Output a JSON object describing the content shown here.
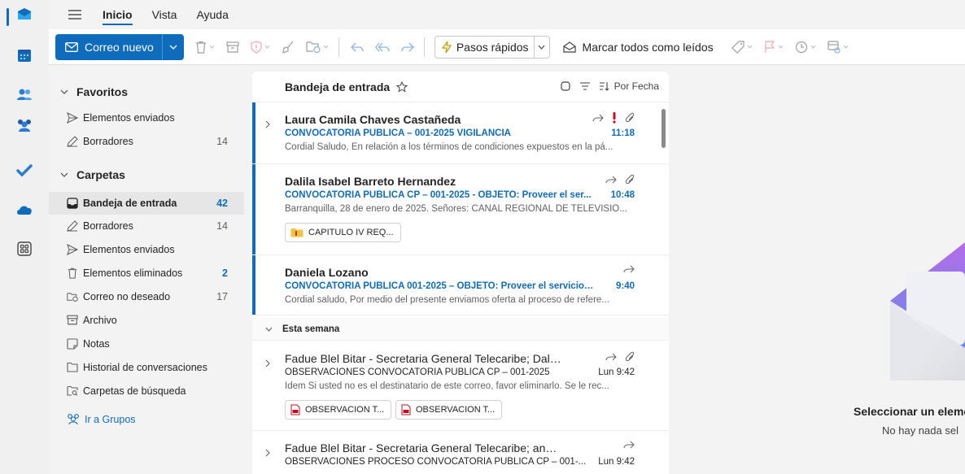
{
  "menu": {
    "tabs": [
      "Inicio",
      "Vista",
      "Ayuda"
    ]
  },
  "toolbar": {
    "new_mail": "Correo nuevo",
    "quick_steps": "Pasos rápidos",
    "mark_all_read": "Marcar todos como leídos"
  },
  "folders": {
    "favorites_label": "Favoritos",
    "favorites": [
      {
        "name": "Elementos enviados",
        "count": ""
      },
      {
        "name": "Borradores",
        "count": "14"
      }
    ],
    "folders_label": "Carpetas",
    "items": [
      {
        "name": "Bandeja de entrada",
        "count": "42"
      },
      {
        "name": "Borradores",
        "count": "14"
      },
      {
        "name": "Elementos enviados",
        "count": ""
      },
      {
        "name": "Elementos eliminados",
        "count": "2"
      },
      {
        "name": "Correo no deseado",
        "count": "17"
      },
      {
        "name": "Archivo",
        "count": ""
      },
      {
        "name": "Notas",
        "count": ""
      },
      {
        "name": "Historial de conversaciones",
        "count": ""
      },
      {
        "name": "Carpetas de búsqueda",
        "count": ""
      }
    ],
    "groups_link": "Ir a Grupos"
  },
  "list": {
    "title": "Bandeja de entrada",
    "sort_label": "Por Fecha",
    "section_label": "Esta semana",
    "messages": [
      {
        "sender": "Laura Camila Chaves Castañeda",
        "subject": "CONVOCATORIA PÚBLICA – 001-2025 VIGILANCIA",
        "time": "11:18",
        "preview": "Cordial Saludo, En relación a los términos de condiciones expuestos en la pá..."
      },
      {
        "sender": "Dalila Isabel Barreto Hernandez",
        "subject": "CONVOCATORIA PÚBLICA CP – 001-2025 - OBJETO: Proveer el ser...",
        "time": "10:48",
        "preview": "Barranquilla, 28 de enero de 2025. Señores: CANAL REGIONAL DE TELEVISIÓ...",
        "attachments": [
          "CAPITULO IV REQ..."
        ]
      },
      {
        "sender": "Daniela Lozano",
        "subject": "CONVOCATORIA PÚBLICA 001-2025 – OBJETO: Proveer el servicio ...",
        "time": "9:40",
        "preview": "Cordial saludo, Por medio del presente enviamos oferta al proceso de refere..."
      },
      {
        "sender": "Fadue Blel Bitar - Secretaria General Telecaribe; Dalila Isa...",
        "subject": "OBSERVACIONES CONVOCATORIA PÚBLICA CP – 001-2025",
        "time": "Lun 9:42",
        "preview": "Idem Si usted no es el destinatario de este correo, favor eliminarlo. Se le rec...",
        "attachments": [
          "OBSERVACION T...",
          "OBSERVACION T..."
        ]
      },
      {
        "sender": "Fadue Blel Bitar - Secretaria General Telecaribe; analistalicitac...",
        "subject": "OBSERVACIONES PROCESO CONVOCATORIA PÚBLICA CP – 001-...",
        "time": "Lun 9:42",
        "preview": ""
      }
    ]
  },
  "reading": {
    "empty_title": "Seleccionar un eleme",
    "empty_subtitle": "No hay nada sel"
  },
  "colors": {
    "accent": "#0f6cbd",
    "flag_red": "#c50f1f"
  }
}
